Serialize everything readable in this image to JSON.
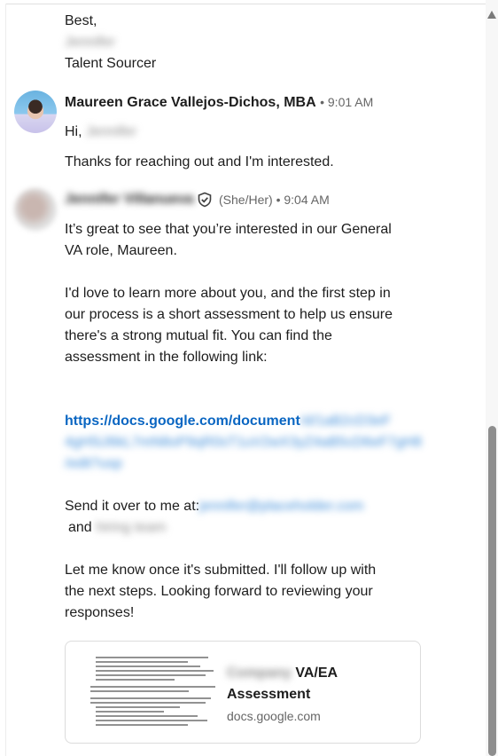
{
  "closing": {
    "best": "Best,",
    "name_redacted": "Jennifer",
    "title": "Talent Sourcer"
  },
  "message1": {
    "sender": "Maureen Grace Vallejos-Dichos, MBA",
    "time": "• 9:01 AM",
    "greeting_prefix": "Hi,",
    "greeting_name_redacted": "Jennifer",
    "body": "Thanks for reaching out and I'm interested."
  },
  "message2": {
    "sender_redacted": "Jennifer Villanueva",
    "pronouns_time": "(She/Her) • 9:04 AM",
    "p1_l1": "It’s great to see that you’re interested in our General",
    "p1_l2": "VA role, Maureen.",
    "p2_l1": "I'd love to learn more about you, and the first step in",
    "p2_l2": "our process is a short assessment to help us ensure",
    "p2_l3": "there's a strong mutual fit. You can find the",
    "p2_l4": "assessment in the following link:",
    "link_visible": "https://docs.google.com/document",
    "link_blur1": "/d/1aB2cD3eF",
    "link_blur2": "4gH5iJ6kL7mN8oP9qR0sT1uV2wX3yZ4aB5cD6eF7gH8",
    "link_blur3": "/edit?usp",
    "send_prefix": "Send it over to me at:",
    "send_email_redacted": "jennifer@placeholder.com",
    "and_prefix": "and",
    "and_redacted": "hiring team",
    "p4_l1": "Let me know once it's submitted. I'll follow up with",
    "p4_l2": "the next steps. Looking forward to reviewing your",
    "p4_l3": "responses!"
  },
  "card": {
    "title_redacted": "Company",
    "title_l1_suffix": "VA/EA",
    "title_l2": "Assessment",
    "domain": "docs.google.com"
  },
  "icons": {
    "shield": "shield-check-icon",
    "scroll_up": "chevron-up-icon"
  },
  "colors": {
    "link": "#0a66c2",
    "text": "#1d1d1d",
    "meta": "#666666"
  }
}
